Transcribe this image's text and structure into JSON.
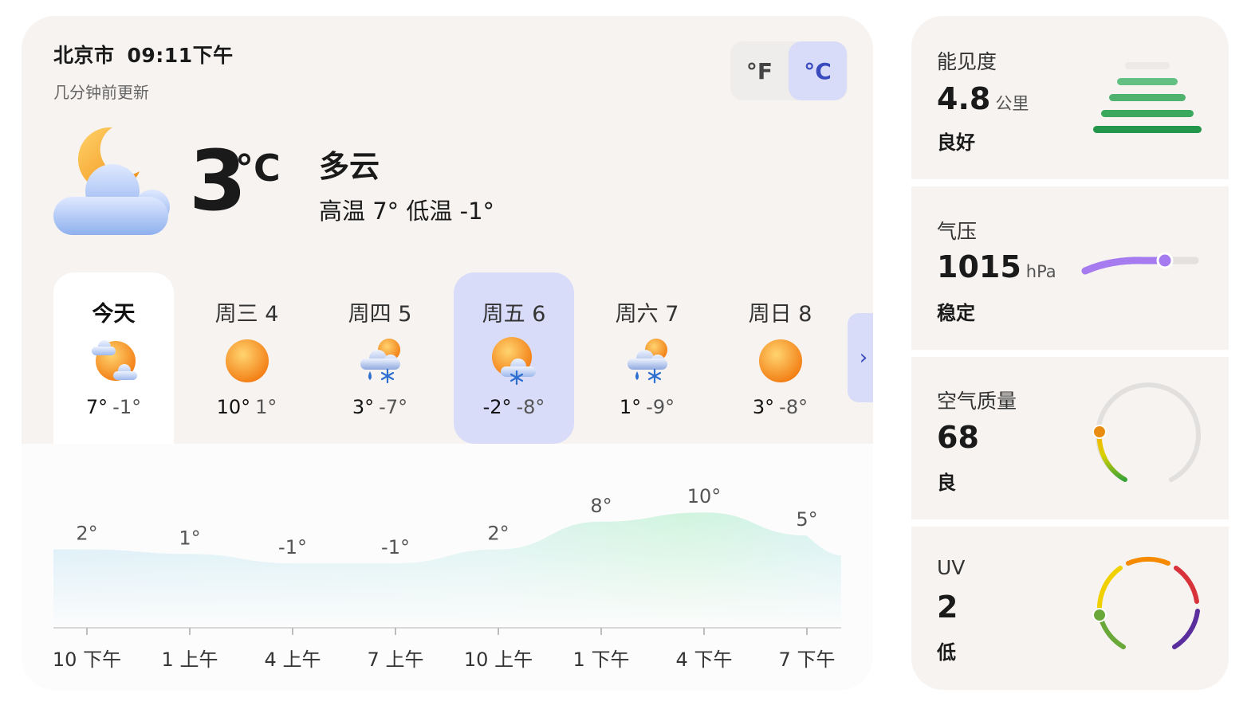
{
  "header": {
    "city": "北京市",
    "time": "09:11下午",
    "updated": "几分钟前更新"
  },
  "units": {
    "fahrenheit": "°F",
    "celsius": "°C",
    "selected": "celsius"
  },
  "current": {
    "icon": "partly-cloudy-night-icon",
    "temp": "3",
    "unit": "°C",
    "condition": "多云",
    "hi_lo": "高温 7°  低温 -1°"
  },
  "days": [
    {
      "label": "今天",
      "icon": "partly-cloudy-icon",
      "hi": "7°",
      "lo": "-1°",
      "state": "today"
    },
    {
      "label": "周三 4",
      "icon": "sunny-icon",
      "hi": "10°",
      "lo": "1°"
    },
    {
      "label": "周四 5",
      "icon": "snow-rain-icon",
      "hi": "3°",
      "lo": "-7°"
    },
    {
      "label": "周五 6",
      "icon": "snow-sun-icon",
      "hi": "-2°",
      "lo": "-8°",
      "state": "selected"
    },
    {
      "label": "周六 7",
      "icon": "snow-rain-icon",
      "hi": "1°",
      "lo": "-9°"
    },
    {
      "label": "周日 8",
      "icon": "sunny-icon",
      "hi": "3°",
      "lo": "-8°"
    }
  ],
  "next_icon": "chevron-right-icon",
  "chart_data": {
    "type": "area",
    "x": [
      "10 下午",
      "1 上午",
      "4 上午",
      "7 上午",
      "10 上午",
      "1 下午",
      "4 下午",
      "7 下午"
    ],
    "values": [
      2,
      1,
      -1,
      -1,
      2,
      8,
      10,
      5
    ],
    "labels": [
      "2°",
      "1°",
      "-1°",
      "-1°",
      "2°",
      "8°",
      "10°",
      "5°"
    ]
  },
  "visibility": {
    "label": "能见度",
    "value": "4.8",
    "unit": "公里",
    "status": "良好",
    "level": 0.8,
    "color": "#2ea44f"
  },
  "pressure": {
    "label": "气压",
    "value": "1015",
    "unit": "hPa",
    "status": "稳定",
    "level": 0.8,
    "color": "#a77bf0"
  },
  "air_quality": {
    "label": "空气质量",
    "value": "68",
    "status": "良"
  },
  "uv": {
    "label": "UV",
    "value": "2",
    "status": "低"
  }
}
